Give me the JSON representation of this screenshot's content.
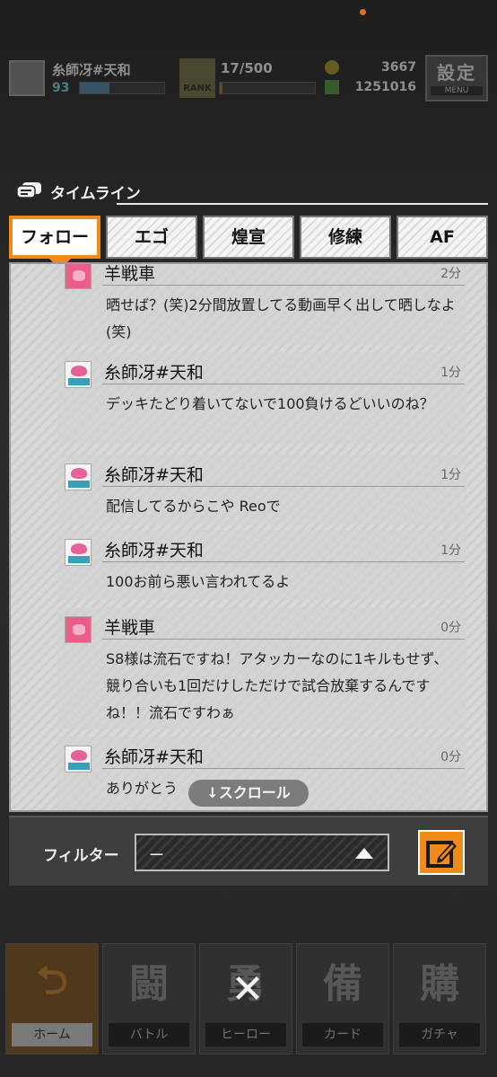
{
  "top_bar": {
    "player_name": "糸師冴#天和",
    "player_level": "93",
    "level_progress": 0.35,
    "rank_progress": "17/500",
    "rank_label": "RANK",
    "rank_fill": 0.03,
    "coins": "3667",
    "gems": "1251016",
    "settings_label": "設定",
    "menu_label": "MENU"
  },
  "timeline": {
    "title": "タイムライン",
    "tabs": [
      {
        "label": "フォロー",
        "active": true
      },
      {
        "label": "エゴ",
        "active": false
      },
      {
        "label": "煌宣",
        "active": false
      },
      {
        "label": "修練",
        "active": false
      },
      {
        "label": "AF",
        "active": false
      }
    ],
    "posts": [
      {
        "avatar": "sheep-avatar",
        "name": "羊戦車",
        "time": "2分",
        "text": "晒せば？(笑)2分間放置してる動画早く出して晒しなよ(笑)"
      },
      {
        "avatar": "itoshi-avatar",
        "name": "糸師冴#天和",
        "time": "1分",
        "text": "デッキたどり着いてないで100負けるどいいのね？"
      },
      {
        "avatar": "itoshi-avatar",
        "name": "糸師冴#天和",
        "time": "1分",
        "text": "配信してるからこや Reoで"
      },
      {
        "avatar": "itoshi-avatar",
        "name": "糸師冴#天和",
        "time": "1分",
        "text": "100お前ら悪い言われてるよ"
      },
      {
        "avatar": "sheep-avatar",
        "name": "羊戦車",
        "time": "0分",
        "text": "S8様は流石ですね！アタッカーなのに1キルもせず、競り合いも1回だけしただけで試合放棄するんですね！！流石ですわぁ"
      },
      {
        "avatar": "itoshi-avatar",
        "name": "糸師冴#天和",
        "time": "0分",
        "text": "ありがとう"
      }
    ],
    "scroll_hint": "↓スクロール"
  },
  "filter": {
    "label": "フィルター",
    "value": "ー"
  },
  "bottom_nav": [
    {
      "glyph": "⮌",
      "label": "ホーム"
    },
    {
      "glyph": "闘",
      "label": "バトル"
    },
    {
      "glyph": "勇",
      "label": "ヒーロー"
    },
    {
      "glyph": "備",
      "label": "カード"
    },
    {
      "glyph": "購",
      "label": "ガチャ"
    }
  ],
  "close_symbol": "✕",
  "colors": {
    "accent": "#f08a18",
    "panel": "#d8d8d8",
    "overlay": "#2a2a2a"
  }
}
